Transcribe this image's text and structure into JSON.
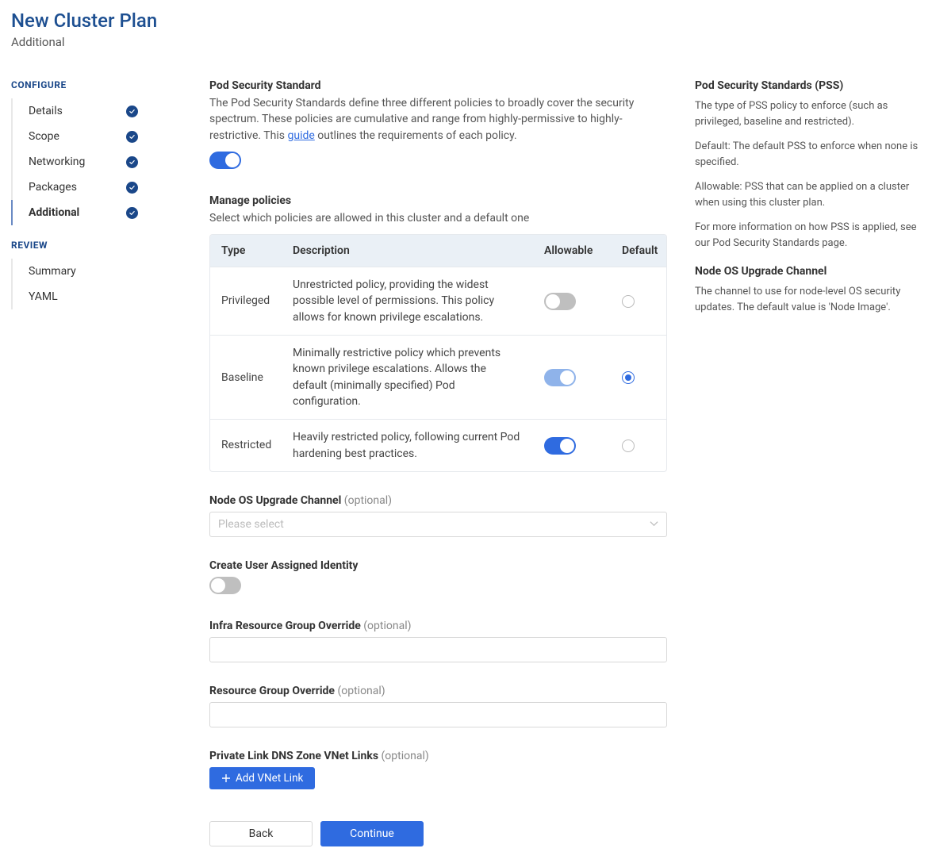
{
  "header": {
    "title": "New Cluster Plan",
    "subtitle": "Additional"
  },
  "sidebar": {
    "configure_heading": "CONFIGURE",
    "review_heading": "REVIEW",
    "configure": [
      {
        "label": "Details",
        "done": true,
        "active": false
      },
      {
        "label": "Scope",
        "done": true,
        "active": false
      },
      {
        "label": "Networking",
        "done": true,
        "active": false
      },
      {
        "label": "Packages",
        "done": true,
        "active": false
      },
      {
        "label": "Additional",
        "done": true,
        "active": true
      }
    ],
    "review": [
      {
        "label": "Summary"
      },
      {
        "label": "YAML"
      }
    ]
  },
  "pss": {
    "title": "Pod Security Standard",
    "desc_prefix": "The Pod Security Standards define three different policies to broadly cover the security spectrum. These policies are cumulative and range from highly-permissive to highly-restrictive. This ",
    "desc_link": "guide",
    "desc_suffix": " outlines the requirements of each policy.",
    "enabled": true
  },
  "policies": {
    "title": "Manage policies",
    "desc": "Select which policies are allowed in this cluster and a default one",
    "columns": {
      "type": "Type",
      "description": "Description",
      "allowable": "Allowable",
      "default": "Default"
    },
    "rows": [
      {
        "type": "Privileged",
        "desc": "Unrestricted policy, providing the widest possible level of permissions. This policy allows for known privilege escalations.",
        "allowable": "off",
        "default": false
      },
      {
        "type": "Baseline",
        "desc": "Minimally restrictive policy which prevents known privilege escalations. Allows the default (minimally specified) Pod configuration.",
        "allowable": "on-light",
        "default": true
      },
      {
        "type": "Restricted",
        "desc": "Heavily restricted policy, following current Pod hardening best practices.",
        "allowable": "on",
        "default": false
      }
    ]
  },
  "nodeos": {
    "label": "Node OS Upgrade Channel",
    "optional": " (optional)",
    "placeholder": "Please select"
  },
  "identity": {
    "label": "Create User Assigned Identity",
    "enabled": false
  },
  "infra_rg": {
    "label": "Infra Resource Group Override",
    "optional": " (optional)",
    "value": ""
  },
  "rg": {
    "label": "Resource Group Override",
    "optional": " (optional)",
    "value": ""
  },
  "vnet": {
    "label": "Private Link DNS Zone VNet Links",
    "optional": " (optional)",
    "button": "Add VNet Link"
  },
  "actions": {
    "back": "Back",
    "continue": "Continue"
  },
  "help": {
    "pss_title": "Pod Security Standards (PSS)",
    "pss_p1": "The type of PSS policy to enforce (such as privileged, baseline and restricted).",
    "pss_p2": "Default: The default PSS to enforce when none is specified.",
    "pss_p3": "Allowable: PSS that can be applied on a cluster when using this cluster plan.",
    "pss_p4": "For more information on how PSS is applied, see our Pod Security Standards page.",
    "node_title": "Node OS Upgrade Channel",
    "node_p1": "The channel to use for node-level OS security updates. The default value is 'Node Image'."
  }
}
